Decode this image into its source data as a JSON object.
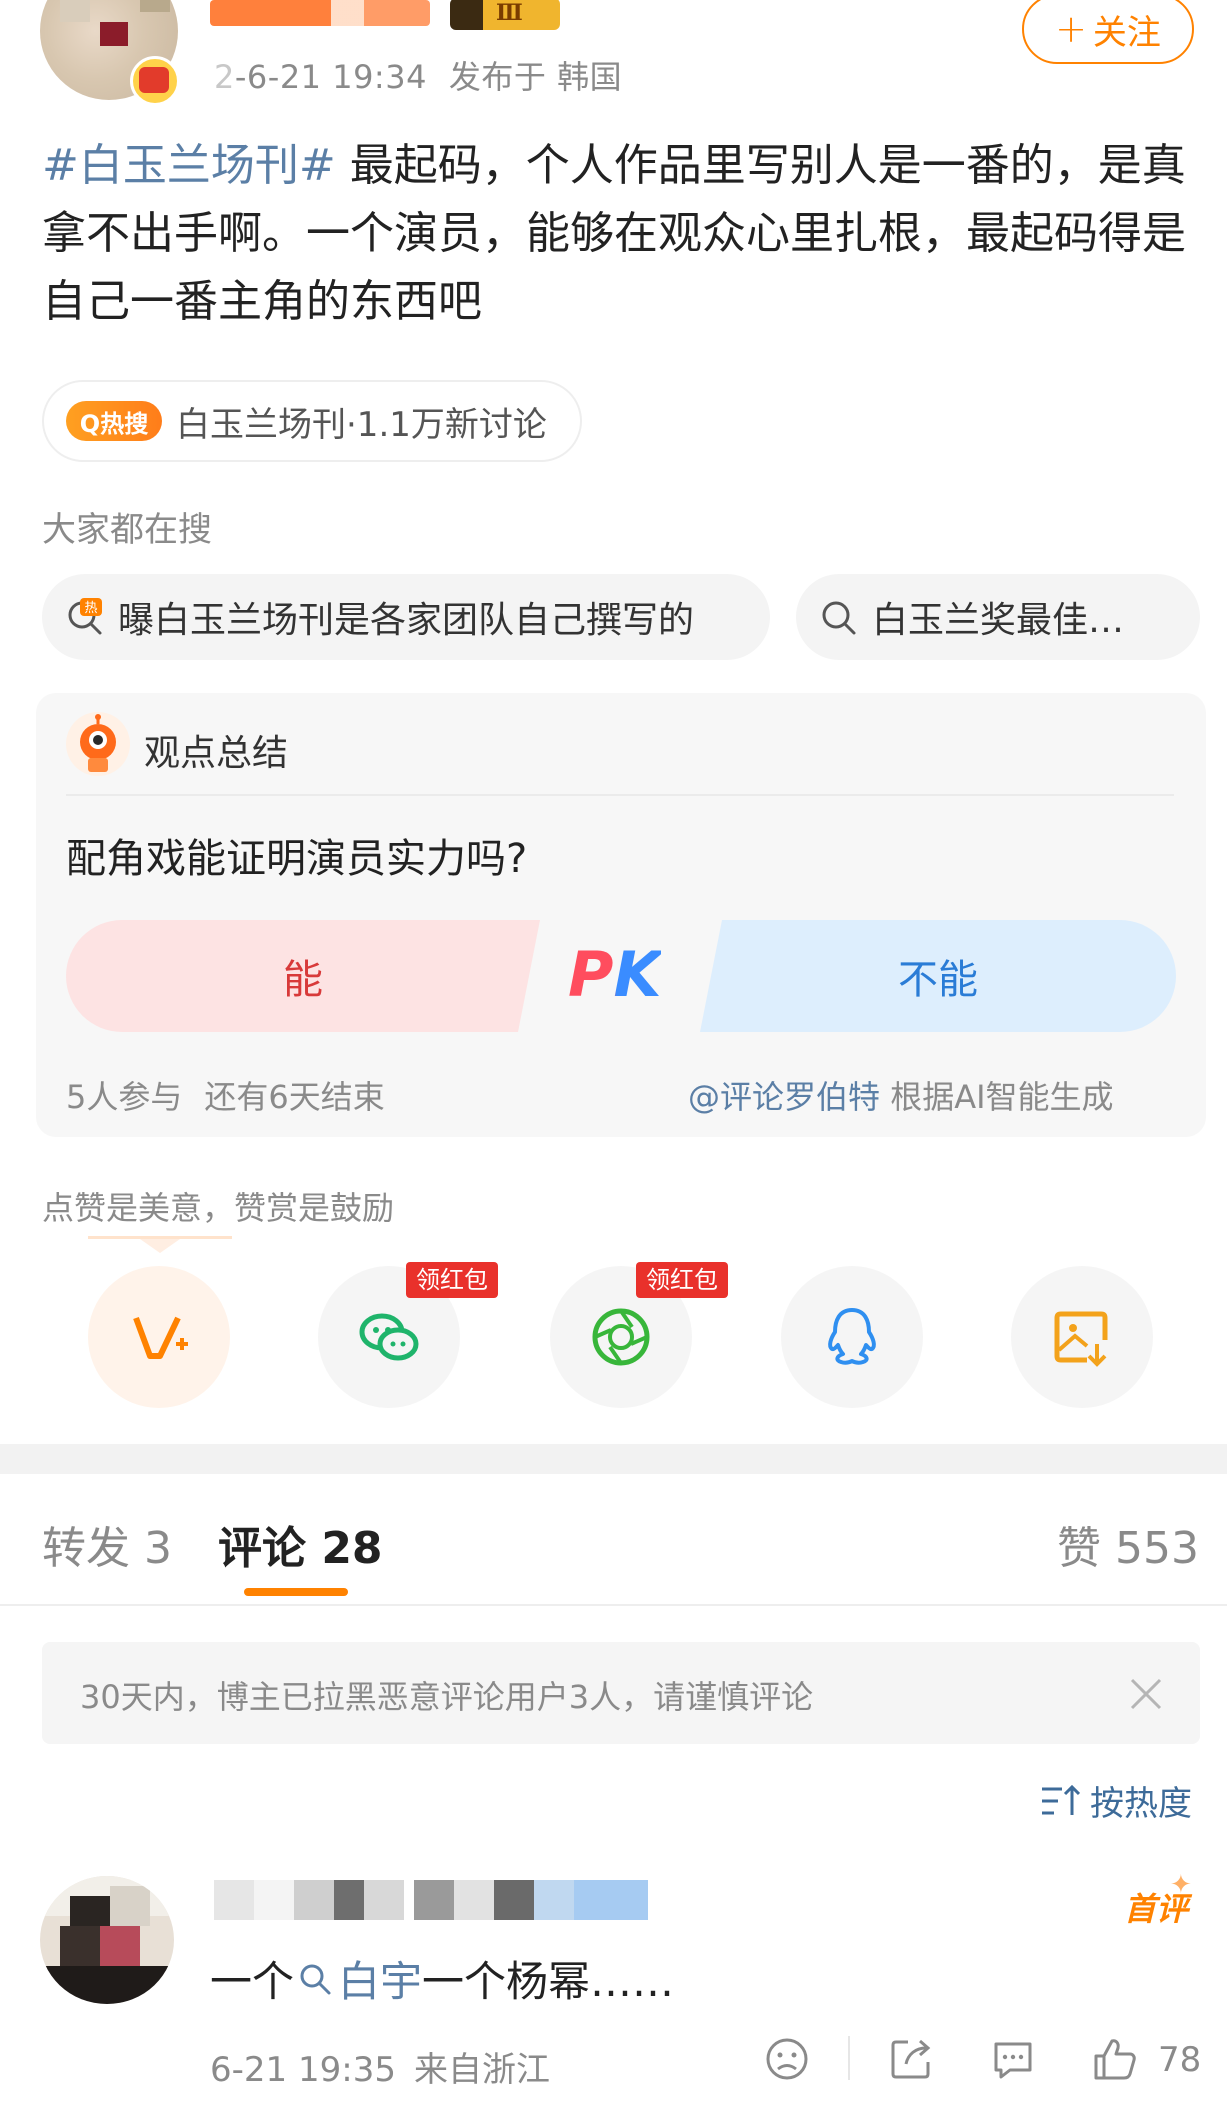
{
  "post": {
    "time": "-6-21 19:34",
    "time_prefix": "2",
    "location": "发布于 韩国",
    "follow_label": "关注",
    "level_badge": "Ⅲ",
    "topic": "#白玉兰场刊#",
    "body": " 最起码，个人作品里写别人是一番的，是真拿不出手啊。一个演员，能够在观众心里扎根，最起码得是自己一番主角的东西吧"
  },
  "hot": {
    "tag": "Q热搜",
    "text": "白玉兰场刊·1.1万新讨论"
  },
  "search": {
    "title": "大家都在搜",
    "items": [
      "曝白玉兰场刊是各家团队自己撰写的",
      "白玉兰奖最佳…"
    ]
  },
  "opinion": {
    "title": "观点总结",
    "question": "配角戏能证明演员实力吗?",
    "option_yes": "能",
    "option_no": "不能",
    "pk": "PK",
    "participants": "5人参与",
    "remaining": "还有6天结束",
    "credit_at": "@评论罗伯特",
    "credit_text": " 根据AI智能生成"
  },
  "reward": {
    "title": "点赞是美意，赞赏是鼓励",
    "redpack_label": "领红包"
  },
  "tabs": {
    "repost": "转发 3",
    "comment": "评论 28",
    "like": "赞 553"
  },
  "notice": {
    "text": "30天内，博主已拉黑恶意评论用户3人，请谨慎评论"
  },
  "sort": {
    "label": "按热度"
  },
  "comment": {
    "badge": "首评",
    "text_before": "一个",
    "link": "白宇",
    "text_after": "一个杨幂……",
    "time": "6-21 19:35",
    "location": "来自浙江",
    "like_count": "78"
  },
  "colors": {
    "accent": "#ff8200",
    "link": "#5b7fa6",
    "redpack": "#e9312b"
  },
  "icons": [
    "search-icon",
    "hot-search-icon",
    "vplus-icon",
    "wechat-icon",
    "moments-icon",
    "qq-icon",
    "save-image-icon",
    "close-icon",
    "sort-icon",
    "dislike-icon",
    "share-icon",
    "comment-icon",
    "like-icon"
  ]
}
